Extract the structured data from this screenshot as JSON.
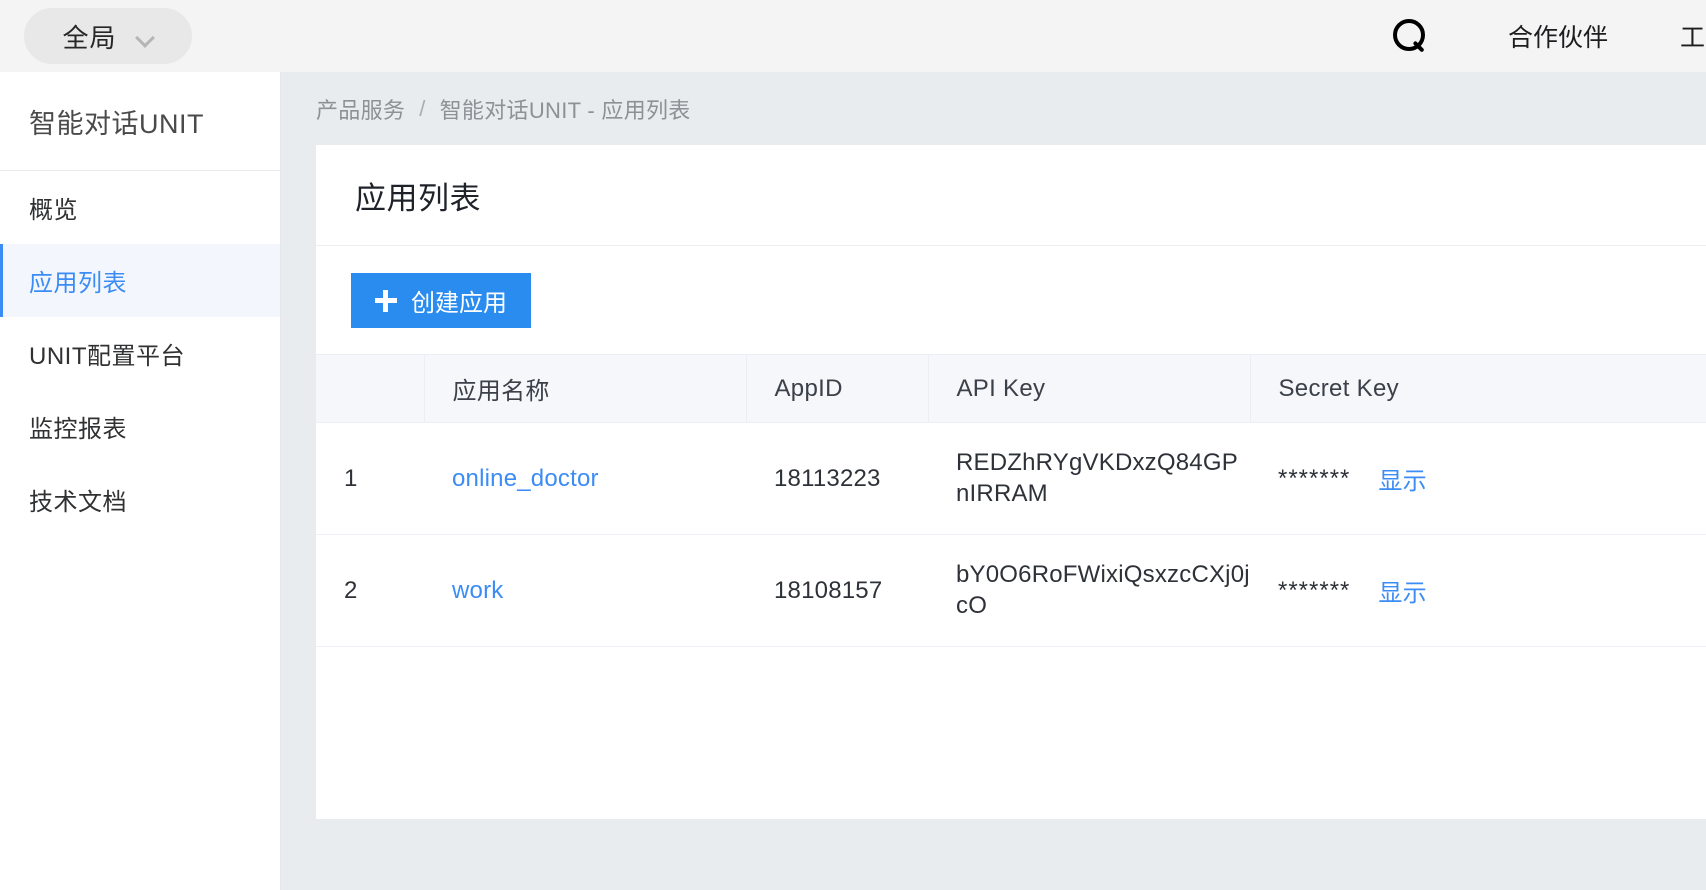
{
  "topbar": {
    "scope_label": "全局",
    "scope_icon": "chevron-down-icon",
    "search_icon": "search-icon",
    "links": [
      {
        "label": "合作伙伴"
      },
      {
        "label": "工单"
      }
    ]
  },
  "sidebar": {
    "title": "智能对话UNIT",
    "items": [
      {
        "label": "概览",
        "active": false
      },
      {
        "label": "应用列表",
        "active": true
      },
      {
        "label": "UNIT配置平台",
        "active": false
      },
      {
        "label": "监控报表",
        "active": false
      },
      {
        "label": "技术文档",
        "active": false
      }
    ]
  },
  "breadcrumb": {
    "root": "产品服务",
    "separator": "/",
    "current": "智能对话UNIT - 应用列表"
  },
  "card": {
    "title": "应用列表",
    "create_button": {
      "label": "创建应用",
      "icon": "plus-icon",
      "color": "#2b8cf0"
    }
  },
  "table": {
    "columns": [
      "",
      "应用名称",
      "AppID",
      "API Key",
      "Secret Key"
    ],
    "rows": [
      {
        "index": "1",
        "name": "online_doctor",
        "appid": "18113223",
        "api_key": "REDZhRYgVKDxzQ84GPnIRRAM",
        "secret_mask": "*******",
        "secret_action": "显示"
      },
      {
        "index": "2",
        "name": "work",
        "appid": "18108157",
        "api_key": "bY0O6RoFWixiQsxzcCXj0jcO",
        "secret_mask": "*******",
        "secret_action": "显示"
      }
    ]
  },
  "colors": {
    "accent": "#3c8cf5",
    "button": "#2b8cf0",
    "page_bg": "#e9ecef",
    "topbar_bg": "#f4f4f5",
    "active_nav_bg": "#f3f6fc"
  }
}
